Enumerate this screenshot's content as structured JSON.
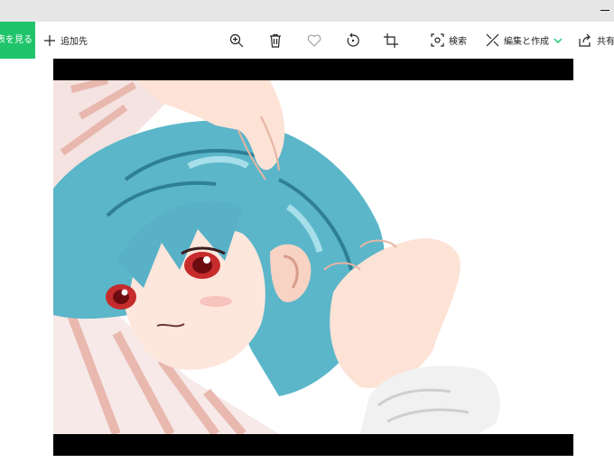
{
  "toolbar": {
    "view_all_label": "表を見る",
    "add_to_label": "追加先",
    "search_label": "検索",
    "edit_create_label": "編集と作成",
    "share_label": "共有"
  },
  "colors": {
    "accent_green": "#1fc46a",
    "titlebar": "#e6e6e6",
    "letterbox": "#000000"
  },
  "icons": [
    "plus-icon",
    "zoom-in-icon",
    "delete-icon",
    "favorite-icon",
    "rotate-icon",
    "crop-icon",
    "visual-search-icon",
    "edit-create-icon",
    "chevron-down-icon",
    "share-icon"
  ]
}
